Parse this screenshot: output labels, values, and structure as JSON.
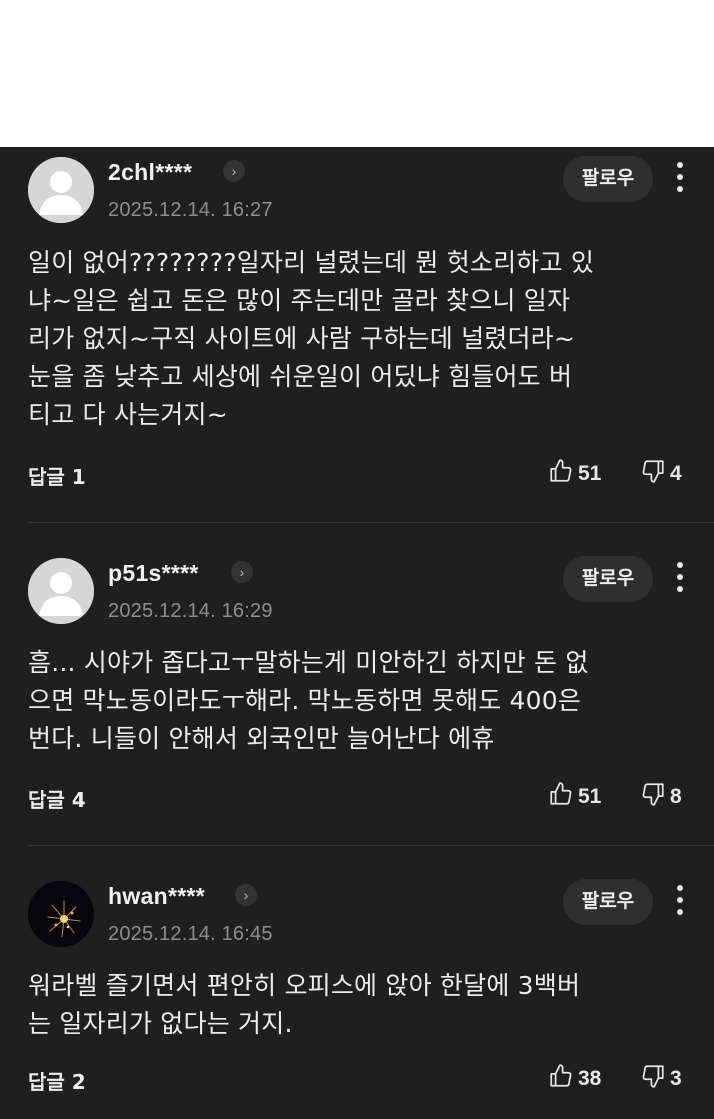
{
  "comments": [
    {
      "author": "2chl****",
      "date": "2025.12.14. 16:27",
      "follow_label": "팔로우",
      "lines": [
        "일이 없어????????일자리 널렸는데 뭔 헛소리하고 있",
        "냐~일은 쉽고 돈은 많이 주는데만 골라 찾으니 일자",
        "리가 없지~구직 사이트에 사람 구하는데 널렸더라~",
        "눈을 좀 낮추고 세상에 쉬운일이 어딨냐 힘들어도 버",
        "티고 다 사는거지~"
      ],
      "replies_label": "답글 1",
      "likes": "51",
      "dislikes": "4",
      "avatar": "default-avatar"
    },
    {
      "author": "p51s****",
      "date": "2025.12.14. 16:29",
      "follow_label": "팔로우",
      "lines": [
        "흠... 시야가 좁다고ㅜ말하는게 미안하긴 하지만 돈 없",
        "으면 막노동이라도ㅜ해라. 막노동하면 못해도 400은",
        "번다. 니들이 안해서 외국인만 늘어난다 에휴"
      ],
      "replies_label": "답글 4",
      "likes": "51",
      "dislikes": "8",
      "avatar": "default-avatar"
    },
    {
      "author": "hwan****",
      "date": "2025.12.14. 16:45",
      "follow_label": "팔로우",
      "lines": [
        "워라벨 즐기면서 편안히 오피스에 앉아 한달에 3백버",
        "는 일자리가 없다는 거지."
      ],
      "replies_label": "답글 2",
      "likes": "38",
      "dislikes": "3",
      "avatar": "fireworks-avatar"
    }
  ],
  "colors": {
    "background": "#1f1f1f",
    "text": "#ececec",
    "meta": "#8e8e8e",
    "follow_button": "#2f2f2f"
  },
  "icons": [
    "chevron-right-icon",
    "more-vertical-icon",
    "thumbs-up-icon",
    "thumbs-down-icon"
  ]
}
